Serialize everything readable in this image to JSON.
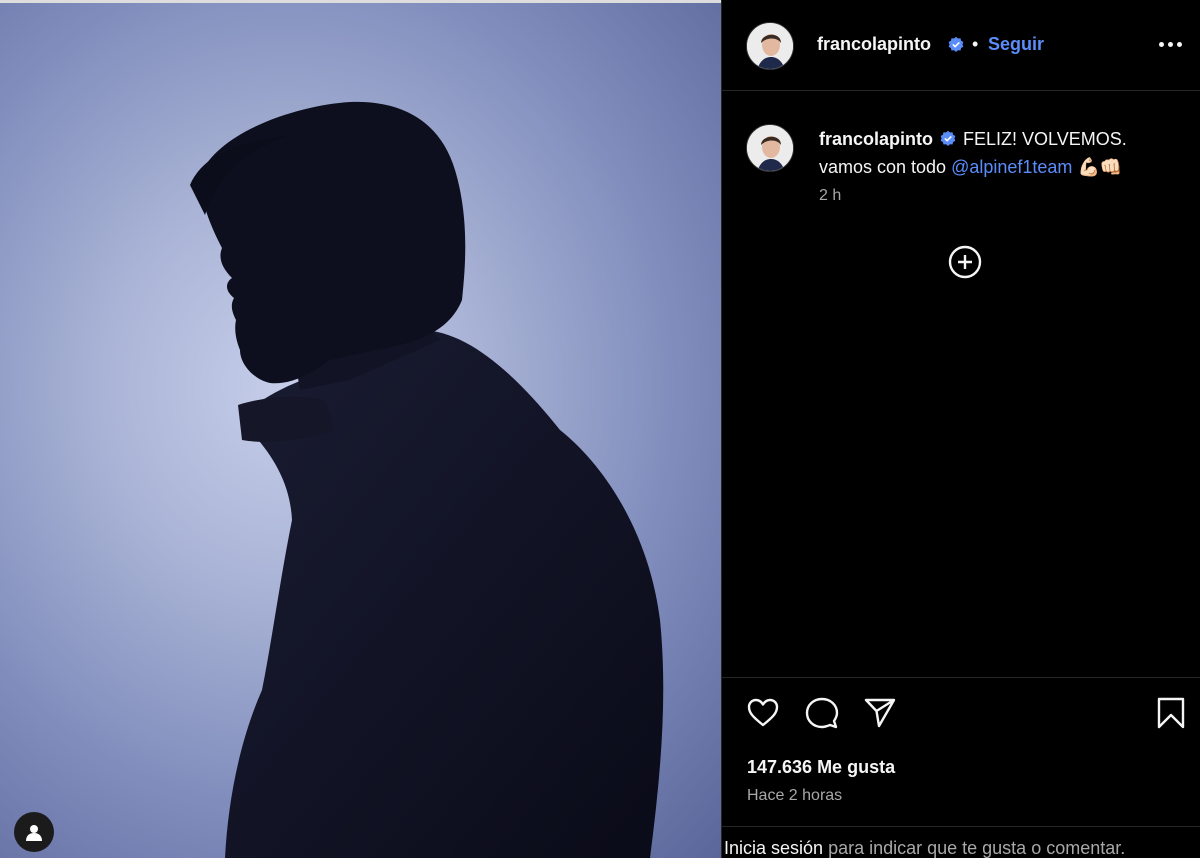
{
  "post": {
    "username": "francolapinto",
    "follow_label": "Seguir",
    "separator": "•",
    "caption_text": "FELIZ! VOLVEMOS.",
    "caption_line2": "vamos con todo ",
    "mention": "@alpinef1team",
    "emojis": "💪🏻👊🏻",
    "caption_time": "2 h",
    "likes": "147.636 Me gusta",
    "posted_ago": "Hace 2 horas",
    "login_link": "Inicia sesión",
    "login_rest": " para indicar que te gusta o comentar."
  },
  "icons": {
    "verified": "verified-badge-icon",
    "more": "more-options-icon",
    "add_comment": "add-circle-icon",
    "like": "heart-icon",
    "comment": "comment-icon",
    "share": "send-icon",
    "save": "bookmark-icon",
    "tag": "user-tag-icon"
  },
  "colors": {
    "accent": "#5b8dfa",
    "background": "#000000",
    "muted": "#a8a8a8"
  }
}
